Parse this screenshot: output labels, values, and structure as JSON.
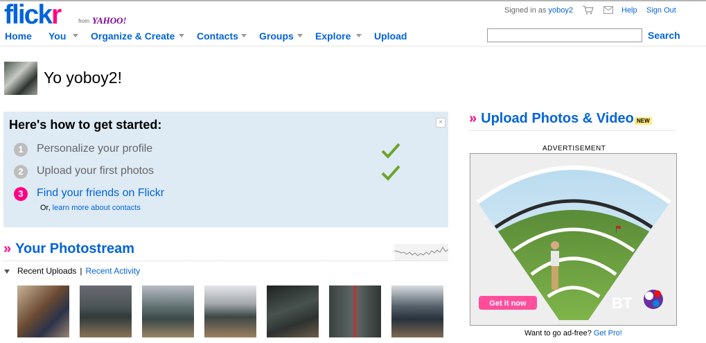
{
  "brand": {
    "logo_blue": "flick",
    "logo_pink": "r",
    "from": "from",
    "yahoo": "YAHOO!",
    "colors": {
      "blue": "#0063dc",
      "pink": "#ff0084"
    }
  },
  "account": {
    "signed_in_as": "Signed in as",
    "username": "yoboy2",
    "help": "Help",
    "sign_out": "Sign Out",
    "icons": [
      "cart-icon",
      "mail-icon"
    ]
  },
  "nav": {
    "items": [
      "Home",
      "You",
      "Organize & Create",
      "Contacts",
      "Groups",
      "Explore",
      "Upload"
    ]
  },
  "search": {
    "button": "Search",
    "value": ""
  },
  "greeting": {
    "text": "Yo yoboy2!"
  },
  "get_started": {
    "title": "Here's how to get started:",
    "close": "×",
    "steps": [
      {
        "num": "1",
        "label": "Personalize your profile",
        "done": true
      },
      {
        "num": "2",
        "label": "Upload your first photos",
        "done": true
      },
      {
        "num": "3",
        "label": "Find your friends on Flickr",
        "done": false
      }
    ],
    "sub_prefix": "Or,",
    "sub_link": "learn more about contacts"
  },
  "photostream": {
    "raquo": "»",
    "title": "Your Photostream",
    "tab_active": "Recent Uploads",
    "tab_sep": "|",
    "tab_link": "Recent Activity",
    "thumb_count": 7
  },
  "upload": {
    "raquo": "»",
    "title": "Upload Photos & Video",
    "badge": "NEW"
  },
  "ad": {
    "label": "ADVERTISEMENT",
    "cta": "Get it now",
    "brand": "BT",
    "adfree_text": "Want to go ad-free?",
    "adfree_link": "Get Pro!"
  }
}
